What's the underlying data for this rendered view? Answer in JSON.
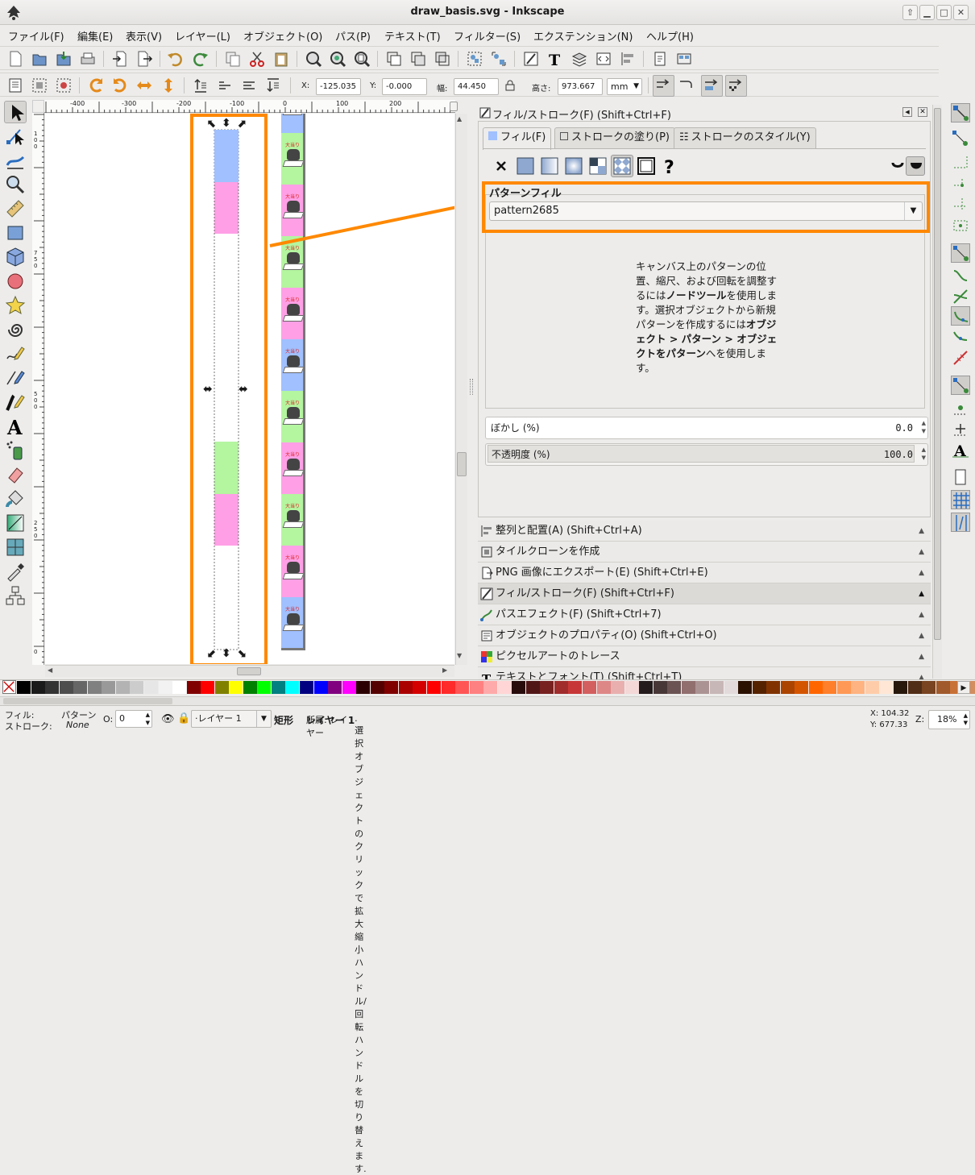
{
  "window": {
    "title": "draw_basis.svg - Inkscape"
  },
  "menu": [
    "ファイル(F)",
    "編集(E)",
    "表示(V)",
    "レイヤー(L)",
    "オブジェクト(O)",
    "パス(P)",
    "テキスト(T)",
    "フィルター(S)",
    "エクステンション(N)",
    "ヘルプ(H)"
  ],
  "toolcontrols": {
    "x_label": "X:",
    "x_value": "-125.035",
    "y_label": "Y:",
    "y_value": "-0.000",
    "w_label": "幅:",
    "w_value": "44.450",
    "h_label": "高さ:",
    "h_value": "973.667",
    "unit": "mm"
  },
  "ruler": {
    "top": [
      "-400",
      "-300",
      "-200",
      "-100",
      "0",
      "100",
      "200"
    ],
    "left": [
      "1",
      "0",
      "0",
      "7",
      "5",
      "0",
      "5",
      "0",
      "0",
      "2",
      "5",
      "0",
      "0"
    ]
  },
  "canvas": {
    "label": "大当り"
  },
  "dock": {
    "header_title": "フィル/ストローク(F) (Shift+Ctrl+F)",
    "tabs": [
      "フィル(F)",
      "ストロークの塗り(P)",
      "ストロークのスタイル(Y)"
    ],
    "section_title": "パターンフィル",
    "pattern_name": "pattern2685",
    "help": {
      "l1": "キャンバス上のパターンの位置、縮尺、および回転を調整するには",
      "b1": "ノードツール",
      "l2": "を使用します。選択オブジェクトから新規パターンを作成するには",
      "b2": "オブジェクト > パターン > オブジェクトをパターン",
      "l3": "へを使用します。"
    },
    "blur_label": "ぼかし (%)",
    "blur_value": "0.0",
    "opacity_label": "不透明度 (%)",
    "opacity_value": "100.0",
    "rows": [
      "整列と配置(A) (Shift+Ctrl+A)",
      "タイルクローンを作成",
      "PNG 画像にエクスポート(E) (Shift+Ctrl+E)",
      "フィル/ストローク(F) (Shift+Ctrl+F)",
      "パスエフェクト(F) (Shift+Ctrl+7)",
      "オブジェクトのプロパティ(O) (Shift+Ctrl+O)",
      "ピクセルアートのトレース",
      "テキストとフォント(T) (Shift+Ctrl+T)"
    ]
  },
  "status": {
    "fill_label": "フィル:",
    "fill_value": "パターン",
    "stroke_label": "ストローク:",
    "stroke_value": "None",
    "o_label": "O:",
    "o_value": "0",
    "layer": "·レイヤー 1",
    "object_type": "矩形",
    "message_a": "所属: レイヤー ",
    "message_b": "レイヤー 1",
    "message_c": ". 選択オブジェクトのクリックで拡大縮小ハンドル/回転ハンドルを切り替えます.",
    "cx": "X:  104.32",
    "cy": "Y:  677.33",
    "z_label": "Z:",
    "zoom": "18%"
  },
  "colors": {
    "accent": "#ff8800",
    "blue": "#a0c0ff",
    "green": "#b4f5a0",
    "pink": "#ffa0e6",
    "select": "#5a86d6"
  }
}
